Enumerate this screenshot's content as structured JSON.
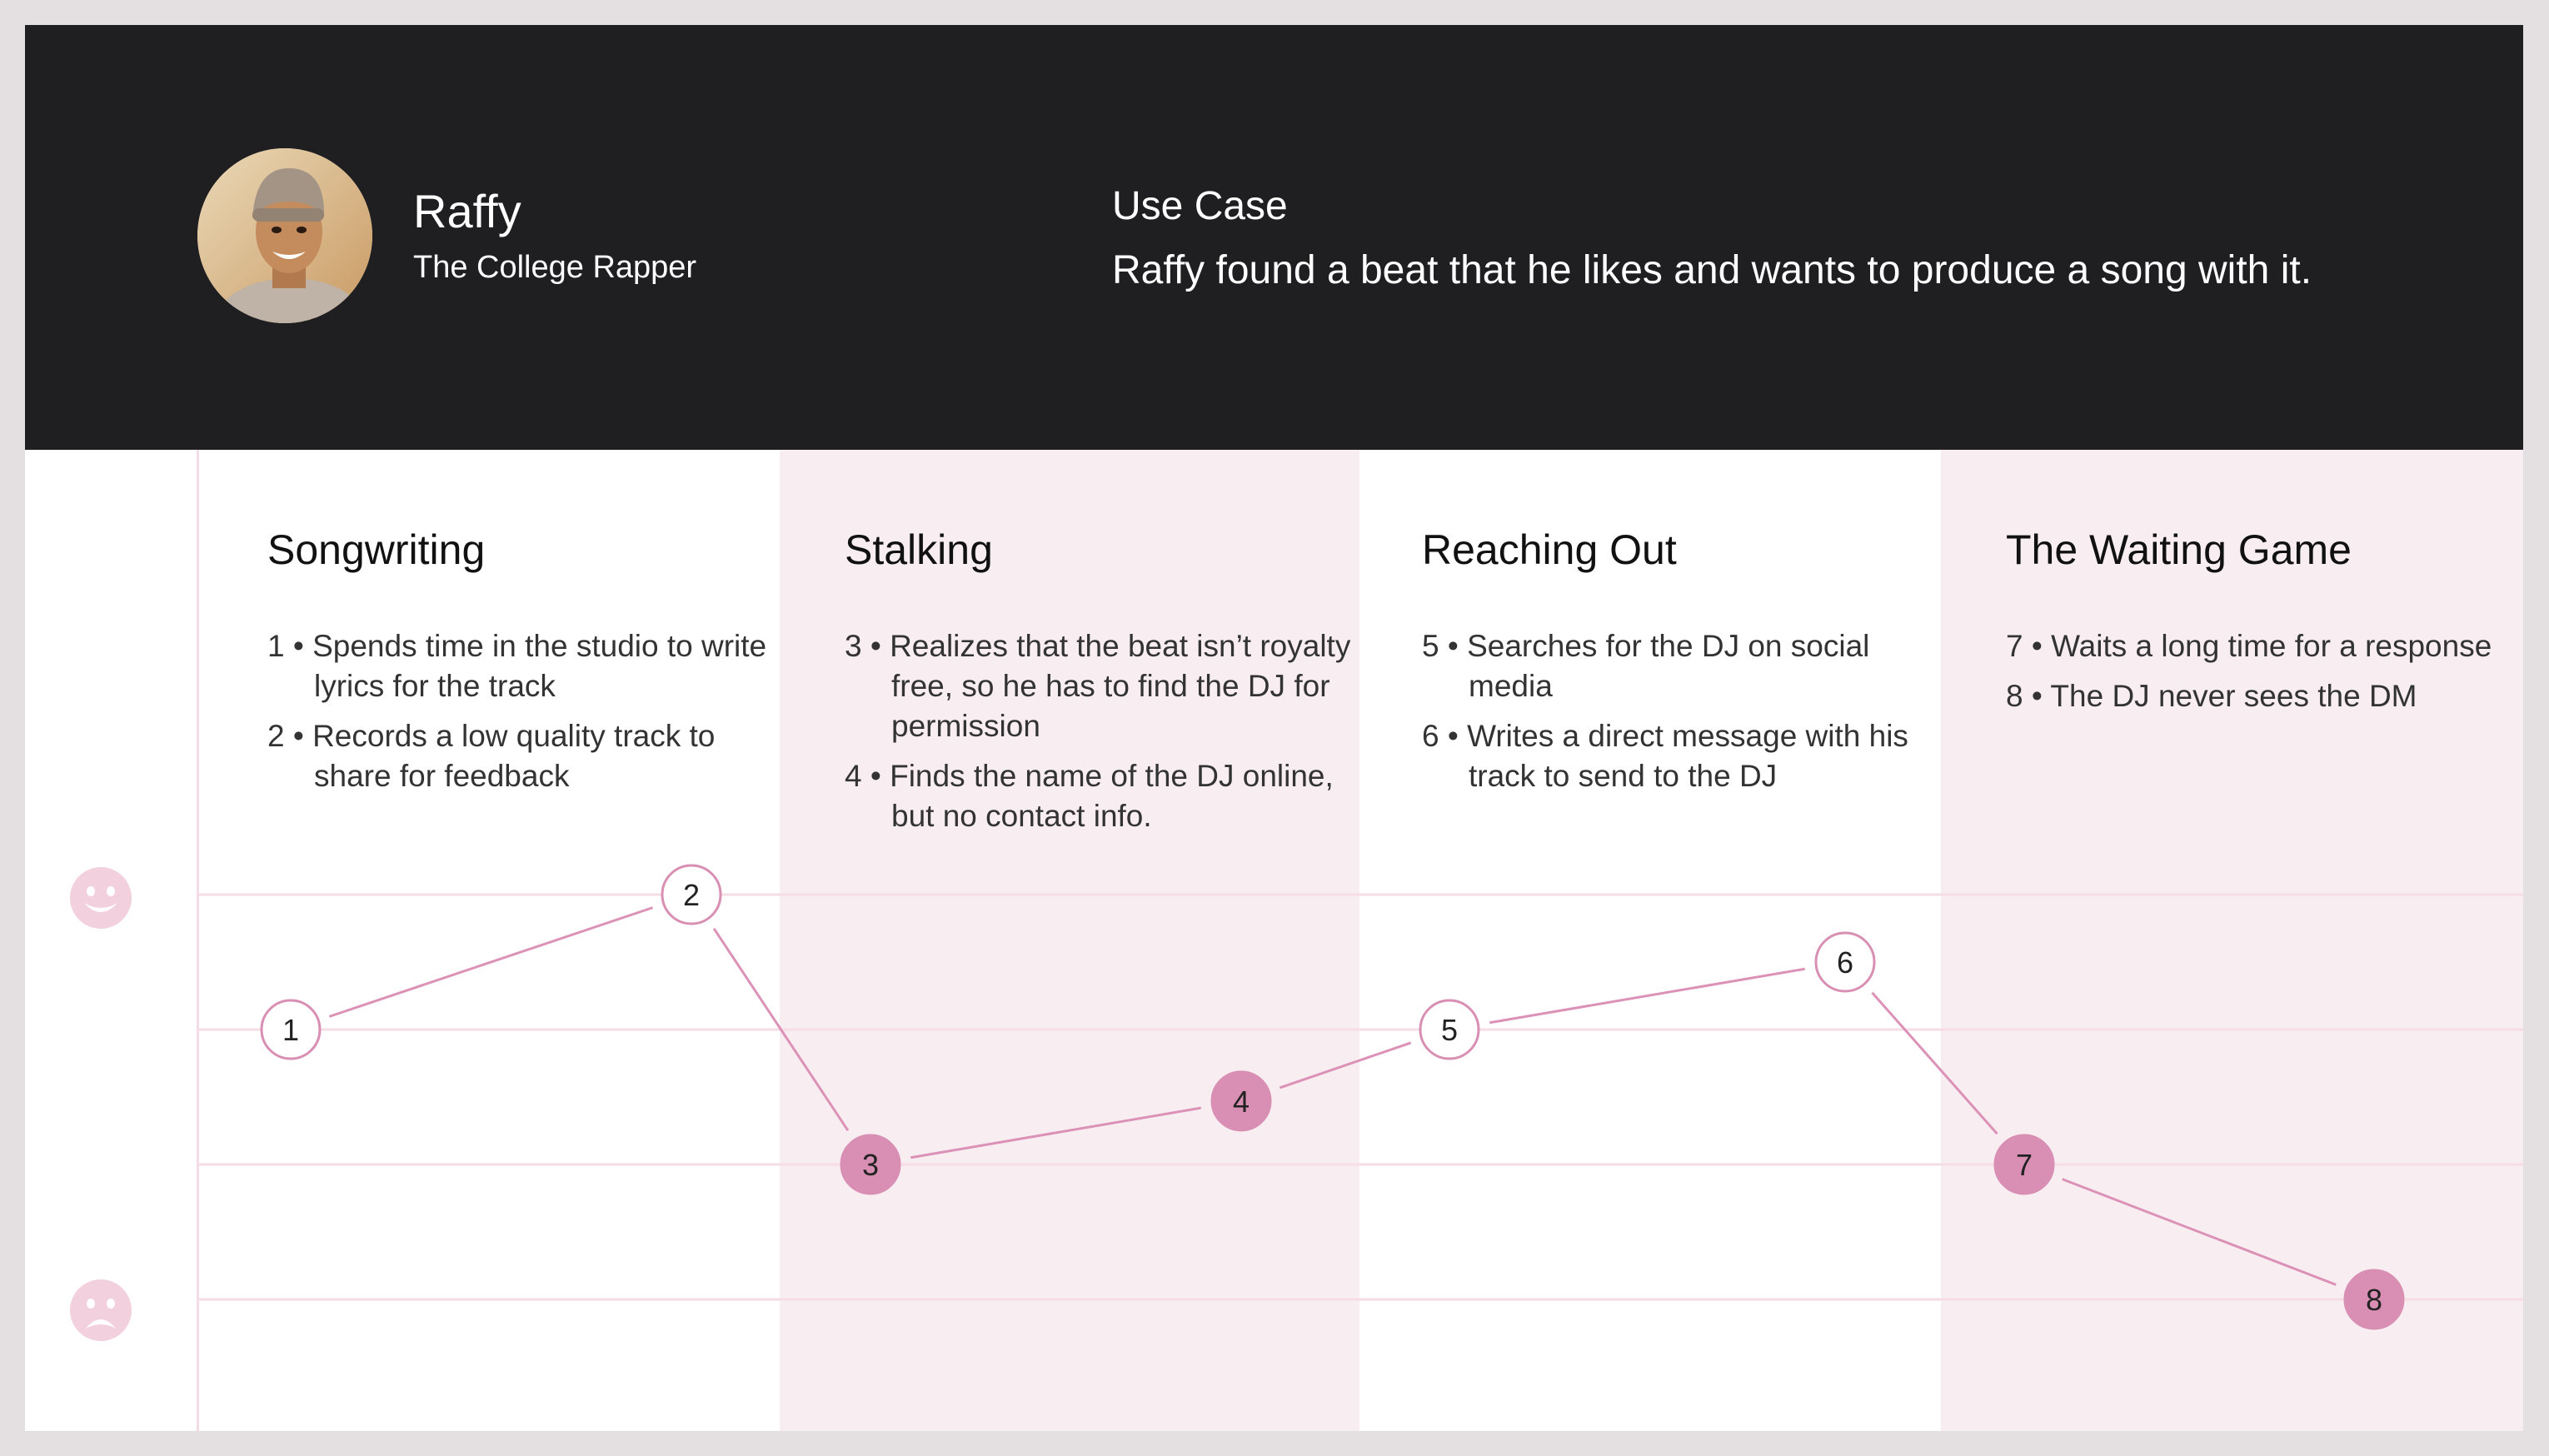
{
  "persona": {
    "name": "Raffy",
    "role": "The College Rapper"
  },
  "use_case": {
    "title": "Use Case",
    "text": "Raffy found a beat that he likes and wants to produce a song with it."
  },
  "colors": {
    "header_bg": "#1f1f22",
    "tint": "#f8eef2",
    "accent": "#d98fb3",
    "line": "#dc91b6",
    "grid": "#f6dce6"
  },
  "icons": {
    "happy": "smiley-face-icon",
    "sad": "sad-face-icon"
  },
  "stages": [
    {
      "title": "Songwriting",
      "steps": [
        "1 • Spends time in the studio to write lyrics for the track",
        "2 • Records a low quality track to share for feedback"
      ]
    },
    {
      "title": "Stalking",
      "steps": [
        "3 • Realizes that the beat isn’t royalty free, so he has to find the DJ for permission",
        "4 • Finds the name of the DJ online, but no contact info."
      ]
    },
    {
      "title": "Reaching Out",
      "steps": [
        "5 • Searches for the DJ on social media",
        "6 • Writes a direct message with his track to send to the DJ"
      ]
    },
    {
      "title": "The Waiting Game",
      "steps": [
        "7 • Waits a long time for a response",
        "8 • The DJ never sees the DM"
      ]
    }
  ],
  "journey_points": [
    {
      "label": "1",
      "stage": 0,
      "level": 2,
      "mood": "neutral"
    },
    {
      "label": "2",
      "stage": 0,
      "level": 3,
      "mood": "neutral"
    },
    {
      "label": "3",
      "stage": 1,
      "level": 1,
      "mood": "negative"
    },
    {
      "label": "4",
      "stage": 1,
      "level": 1.47,
      "mood": "negative"
    },
    {
      "label": "5",
      "stage": 2,
      "level": 2,
      "mood": "neutral"
    },
    {
      "label": "6",
      "stage": 2,
      "level": 2.5,
      "mood": "neutral"
    },
    {
      "label": "7",
      "stage": 3,
      "level": 1,
      "mood": "negative"
    },
    {
      "label": "8",
      "stage": 3,
      "level": 0,
      "mood": "negative"
    }
  ]
}
